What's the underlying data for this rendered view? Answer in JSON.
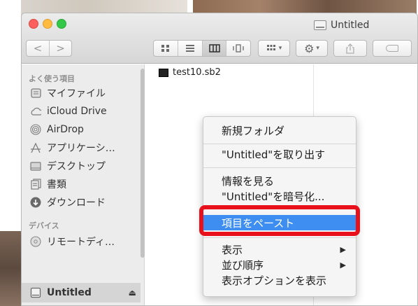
{
  "window": {
    "title": "Untitled"
  },
  "toolbar": {
    "back_label": "<",
    "forward_label": ">",
    "view_icon": "icon-view",
    "view_list": "list-view",
    "view_columns": "column-view",
    "view_coverflow": "coverflow-view"
  },
  "sidebar": {
    "favorites_header": "よく使う項目",
    "favorites": [
      {
        "label": "マイファイル",
        "icon": "all-my-files-icon"
      },
      {
        "label": "iCloud Drive",
        "icon": "cloud-icon"
      },
      {
        "label": "AirDrop",
        "icon": "airdrop-icon"
      },
      {
        "label": "アプリケーシ…",
        "icon": "applications-icon"
      },
      {
        "label": "デスクトップ",
        "icon": "desktop-icon"
      },
      {
        "label": "書類",
        "icon": "documents-icon"
      },
      {
        "label": "ダウンロード",
        "icon": "downloads-icon"
      }
    ],
    "devices_header": "デバイス",
    "devices": [
      {
        "label": "リモートディ…",
        "icon": "remote-disc-icon"
      },
      {
        "label": "Untitled",
        "icon": "drive-icon",
        "eject": "⏏"
      }
    ]
  },
  "files": [
    {
      "name": "test10.sb2"
    }
  ],
  "context_menu": {
    "items": [
      {
        "label": "新規フォルダ"
      },
      {
        "label": "\"Untitled\"を取り出す"
      },
      {
        "label": "情報を見る"
      },
      {
        "label": "\"Untitled\"を暗号化..."
      },
      {
        "label": "項目をペースト",
        "highlighted": true
      },
      {
        "label": "表示",
        "submenu": "▶"
      },
      {
        "label": "並び順序",
        "submenu": "▶"
      },
      {
        "label": "表示オプションを表示"
      }
    ]
  },
  "colors": {
    "selection": "#3d8ef0",
    "highlight_box": "#e8101a"
  }
}
